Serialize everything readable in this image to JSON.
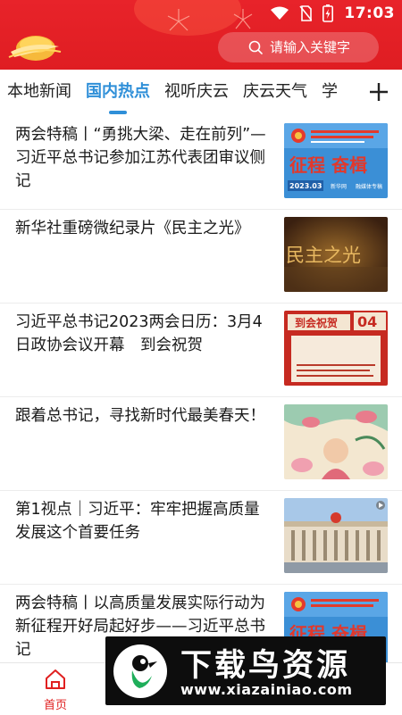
{
  "status_bar": {
    "time": "17:03",
    "icons": [
      "wifi-icon",
      "no-sim-icon",
      "battery-icon"
    ]
  },
  "header": {
    "logo": "qingyun-logo",
    "search": {
      "placeholder": "请输入关键字"
    }
  },
  "tabs": [
    {
      "label": "本地新闻",
      "active": false
    },
    {
      "label": "国内热点",
      "active": true
    },
    {
      "label": "视听庆云",
      "active": false
    },
    {
      "label": "庆云天气",
      "active": false
    },
    {
      "label": "学",
      "active": false
    }
  ],
  "news": [
    {
      "title": "两会特稿丨“勇挑大梁、走在前列”—习近平总书记参加江苏代表团审议侧记",
      "thumb": "征程 奋楫 2023.03 新华网"
    },
    {
      "title": "新华社重磅微纪录片《民主之光》",
      "thumb": "民主之光"
    },
    {
      "title": "习近平总书记2023两会日历：3月4日政协会议开幕　到会祝贺",
      "thumb": "到会祝贺 04"
    },
    {
      "title": "跟着总书记，寻找新时代最美春天！",
      "thumb": "spring-illustration"
    },
    {
      "title": "第1视点｜习近平：牢牢把握高质量发展这个首要任务",
      "thumb": "great-hall-photo"
    },
    {
      "title": "两会特稿丨以高质量发展实际行动为新征程开好局起好步——习近平总书记",
      "thumb": "征程 奋楫"
    }
  ],
  "bottom_nav": {
    "home_label": "首页"
  },
  "watermark": {
    "title": "下载鸟资源",
    "url": "www.xiazainiao.com"
  },
  "colors": {
    "header_red": "#e8232a",
    "active_blue": "#2f8fd8",
    "nav_red": "#e02020"
  }
}
